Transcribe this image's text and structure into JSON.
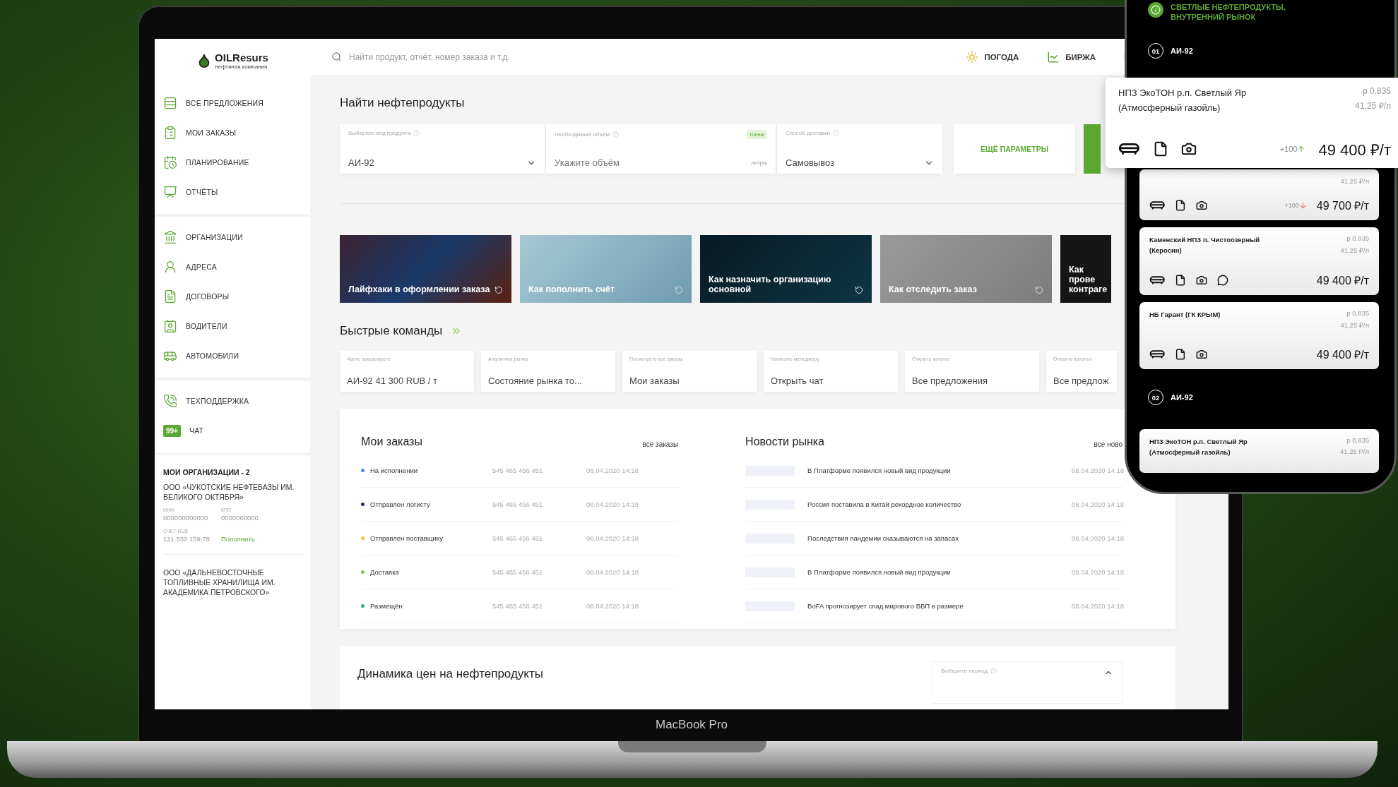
{
  "sidebar": {
    "logo": {
      "name": "OILResurs",
      "tagline": "нефтяная компания"
    },
    "groups": [
      [
        {
          "label": "ВСЕ ПРЕДЛОЖЕНИЯ"
        },
        {
          "label": "МОИ ЗАКАЗЫ"
        },
        {
          "label": "ПЛАНИРОВАНИЕ"
        },
        {
          "label": "ОТЧЁТЫ"
        }
      ],
      [
        {
          "label": "ОРГАНИЗАЦИИ"
        },
        {
          "label": "АДРЕСА"
        },
        {
          "label": "ДОГОВОРЫ"
        },
        {
          "label": "ВОДИТЕЛИ"
        },
        {
          "label": "АВТОМОБИЛИ"
        }
      ],
      [
        {
          "label": "ТЕХПОДДЕРЖКА"
        },
        {
          "label": "ЧАТ",
          "badge": "99+"
        }
      ]
    ],
    "organizations": {
      "title": "МОИ ОРГАНИЗАЦИИ - 2",
      "items": [
        {
          "name": "ООО «ЧУКОТСКИЕ НЕФТЕБАЗЫ ИМ. ВЕЛИКОГО ОКТЯБРЯ»",
          "inn_label": "ИНН",
          "inn": "000000000000",
          "kpp_label": "КПП",
          "kpp": "0000000000",
          "account_label": "СЧЁТ RUB",
          "balance": "121 532 159,78",
          "action": "Пополнить"
        },
        {
          "name": "ООО «ДАЛЬНЕВОСТОЧНЫЕ ТОПЛИВНЫЕ ХРАНИЛИЩА ИМ. АКАДЕМИКА ПЕТРОВСКОГО»"
        }
      ]
    }
  },
  "topbar": {
    "search": {
      "placeholder": "Найти продукт, отчёт, номер заказа и т.д."
    },
    "links": [
      "ПОГОДА",
      "БИРЖА"
    ]
  },
  "finder": {
    "title": "Найти нефтепродукты",
    "fields": [
      {
        "kind": "select",
        "label": "Выберите вид продукта",
        "value": "АИ-92"
      },
      {
        "kind": "volume",
        "label": "Необходимый объём",
        "placeholder": "Укажите объём",
        "tag": "тонны",
        "unit": "литры"
      },
      {
        "kind": "select",
        "label": "Способ доставки",
        "value": "Самовывоз"
      }
    ],
    "more_button": "ЕЩЁ ПАРАМЕТРЫ"
  },
  "guides": [
    "Лайфхаки в оформлении заказа",
    "Как пополнить счёт",
    "Как назначить организацию основной",
    "Как отследить заказ",
    "Как прове контраге"
  ],
  "quick_commands": {
    "title": "Быстрые команды",
    "items": [
      {
        "label": "Часто заказываете",
        "value": "АИ-92   41 300 RUB / т"
      },
      {
        "label": "Аналитика рынка",
        "value": "Состояние рынка то..."
      },
      {
        "label": "Посмотреть все заказы",
        "value": "Мои заказы"
      },
      {
        "label": "Написать менеджеру",
        "value": "Открыть чат"
      },
      {
        "label": "Открыть каталог",
        "value": "Все предложения"
      },
      {
        "label": "Открыть каталог",
        "value": "Все предлож"
      }
    ]
  },
  "orders": {
    "title": "Мои заказы",
    "link": "все заказы",
    "rows": [
      {
        "status": "На исполнении",
        "color": "#4f86e8",
        "number": "545 465 456 451",
        "date": "08.04.2020 14:18"
      },
      {
        "status": "Отправлен логисту",
        "color": "#1f2a6e",
        "number": "545 465 456 451",
        "date": "08.04.2020 14:18"
      },
      {
        "status": "Отправлен поставщику",
        "color": "#e8c23a",
        "number": "545 465 456 451",
        "date": "08.04.2020 14:18"
      },
      {
        "status": "Доставка",
        "color": "#8cc152",
        "number": "545 465 456 451",
        "date": "08.04.2020 14:18"
      },
      {
        "status": "Размещён",
        "color": "#3aa58f",
        "number": "545 465 456 451",
        "date": "08.04.2020 14:18"
      }
    ]
  },
  "news": {
    "title": "Новости рынка",
    "link": "все ново",
    "items": [
      {
        "headline": "В Платформе появился новый вид продукции",
        "date": "08.04.2020 14:18"
      },
      {
        "headline": "Россия поставила в Китай рекордное количество",
        "date": "08.04.2020 14:18"
      },
      {
        "headline": "Последствия пандемии сказываются на запасах",
        "date": "08.04.2020 14:18"
      },
      {
        "headline": "В Платформе появился новый вид продукции",
        "date": "08.04.2020 14:18"
      },
      {
        "headline": "BoFA прогнозирует спад мирового ВВП в размере",
        "date": "08.04.2020 14:18"
      }
    ]
  },
  "price_dynamics": {
    "title": "Динамика цен на нефтепродукты",
    "period_label": "Выберите период"
  },
  "device_label": "MacBook Pro",
  "phone": {
    "section": "СВЕТЛЫЕ НЕФТЕПРОДУКТЫ, ВНУТРЕННИЙ РЫНОК",
    "featured_offer": {
      "title": "НПЗ ЭкоТОН р.п. Светлый Яр (Атмосферный газойль)",
      "density": "р 0,835",
      "per_litre": "41,25 ₽/л",
      "delta": "+100",
      "rising": true,
      "price": "49 400 ₽/т"
    },
    "groups": [
      {
        "index": "01",
        "product": "АИ-92",
        "offers": [
          {
            "per_litre": "41,25 ₽/л",
            "delta": "+100",
            "rising": false,
            "price": "49 700 ₽/т"
          },
          {
            "title": "Каменский НПЗ п. Чистоозерный (Керосин)",
            "density": "р 0,835",
            "per_litre": "41,25 ₽/л",
            "price": "49 400 ₽/т",
            "chat": true
          },
          {
            "title": "НБ Гарант (ГК КРЫМ)",
            "density": "р 0,835",
            "per_litre": "41,25 ₽/л",
            "price": "49 400 ₽/т"
          }
        ]
      },
      {
        "index": "02",
        "product": "АИ-92",
        "offers": [
          {
            "title": "НПЗ ЭкоТОН р.п. Светлый Яр (Атмосферный газойль)",
            "density": "р 0,835",
            "per_litre": "41,25 Р/л"
          }
        ]
      }
    ]
  }
}
